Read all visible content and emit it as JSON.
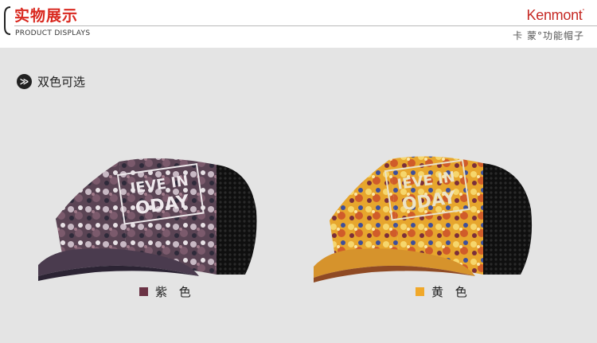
{
  "header": {
    "title_cn": "实物展示",
    "title_en": "PRODUCT DISPLAYS",
    "brand_name": "Kenmont",
    "brand_mark": "°",
    "brand_sub": "卡 蒙°功能帽子",
    "accent_color": "#d9281f"
  },
  "section": {
    "chip_icon": "double-chevron-right-icon",
    "chip_glyph": "≫",
    "label": "双色可选"
  },
  "products": [
    {
      "name": "purple-cap",
      "color_label": "紫 色",
      "swatch_color": "#6b3345",
      "front_text": "BELIEVE IN TODAY"
    },
    {
      "name": "yellow-cap",
      "color_label": "黄 色",
      "swatch_color": "#f0a82a",
      "front_text": "BELIEVE IN TODAY"
    }
  ]
}
